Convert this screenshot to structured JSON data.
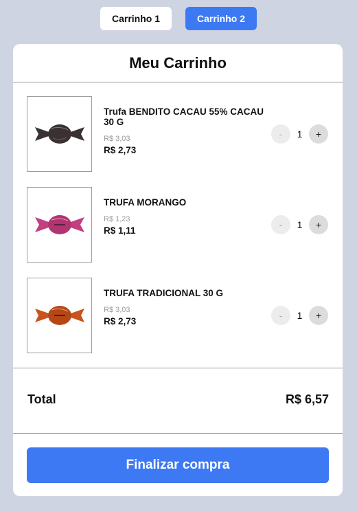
{
  "tabs": [
    {
      "label": "Carrinho 1",
      "active": false
    },
    {
      "label": "Carrinho 2",
      "active": true
    }
  ],
  "cart": {
    "title": "Meu Carrinho",
    "items": [
      {
        "name": "Trufa BENDITO CACAU 55% CACAU 30 G",
        "old_price": "R$ 3,03",
        "price": "R$ 2,73",
        "quantity": "1",
        "minus": "-",
        "plus": "+",
        "wrapper_color": "#3a3232"
      },
      {
        "name": "TRUFA MORANGO",
        "old_price": "R$ 1,23",
        "price": "R$ 1,11",
        "quantity": "1",
        "minus": "-",
        "plus": "+",
        "wrapper_color": "#c2407f"
      },
      {
        "name": "TRUFA TRADICIONAL 30 G",
        "old_price": "R$ 3,03",
        "price": "R$ 2,73",
        "quantity": "1",
        "minus": "-",
        "plus": "+",
        "wrapper_color": "#c8531f"
      }
    ],
    "total_label": "Total",
    "total_value": "R$ 6,57",
    "checkout_label": "Finalizar compra"
  },
  "colors": {
    "accent": "#3d79f2",
    "background": "#cfd4e2"
  }
}
